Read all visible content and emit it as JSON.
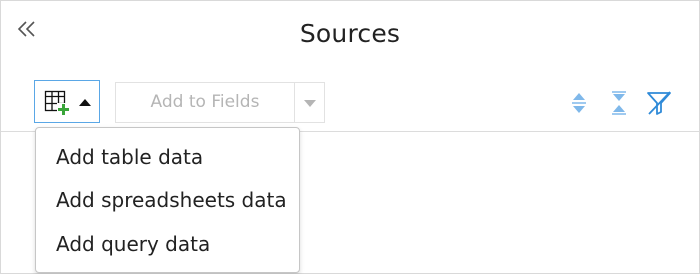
{
  "header": {
    "title": "Sources",
    "collapse_icon": "double-chevron-left-icon"
  },
  "toolbar": {
    "add_source_icon": "table-add-icon",
    "add_to_fields_label": "Add to Fields",
    "add_to_fields_enabled": false,
    "expand_all_icon": "expand-all-icon",
    "collapse_all_icon": "collapse-all-icon",
    "filter_icon": "filter-off-icon"
  },
  "add_source_menu": {
    "open": true,
    "items": [
      {
        "label": "Add table data"
      },
      {
        "label": "Add spreadsheets data"
      },
      {
        "label": "Add query data"
      }
    ]
  },
  "colors": {
    "accent": "#5aa7e6",
    "icon_blue": "#7fb8ea",
    "filter_blue": "#2f8ad8",
    "plus_green": "#3aa53a",
    "disabled_text": "#b5b5b5"
  }
}
